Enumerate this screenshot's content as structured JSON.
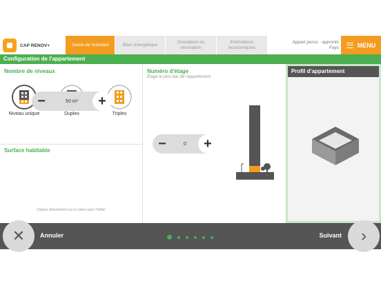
{
  "app": {
    "logo_text": "CAP RENOV+"
  },
  "tabs": [
    {
      "label": "Saisie de l'existant",
      "active": true
    },
    {
      "label": "Bilan énergétique",
      "active": false
    },
    {
      "label": "Simulation de rénovation",
      "active": false
    },
    {
      "label": "Estimations économiques",
      "active": false
    }
  ],
  "user": {
    "line1": "Appart perso - appoints",
    "line2": "Fays"
  },
  "menu": {
    "label": "MENU"
  },
  "page_title": "Configuration de l'appartement",
  "niveaux": {
    "title": "Nombre de niveaux",
    "options": [
      {
        "label": "Niveau unique",
        "selected": true
      },
      {
        "label": "Duplex",
        "selected": false
      },
      {
        "label": "Triplex",
        "selected": false
      }
    ]
  },
  "surface": {
    "title": "Surface habitable",
    "value": "50 m²",
    "hint": "Cliquez directement sur la valeur pour l'éditer"
  },
  "etage": {
    "title": "Numéro d'étage",
    "subtitle": "Étage le plus bas de l'appartement",
    "value": "0"
  },
  "profil": {
    "title": "Profil d'appartement"
  },
  "footer": {
    "cancel_label": "Annuler",
    "next_label": "Suivant",
    "step_count": 6,
    "current_step": 1
  },
  "colors": {
    "accent_orange": "#f39c1f",
    "accent_green": "#4caf50",
    "dark_gray": "#555555"
  }
}
